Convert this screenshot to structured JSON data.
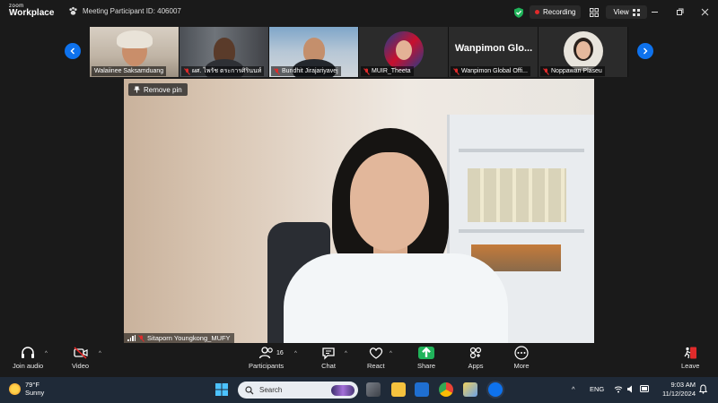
{
  "app": {
    "brand_line1": "zoom",
    "brand_line2": "Workplace",
    "meeting_id": "Meeting Participant ID: 406007",
    "recording_label": "Recording",
    "view_label": "View"
  },
  "thumbnails": [
    {
      "name": "Walaiinee Saksamduang",
      "muted": false
    },
    {
      "name": "ผศ. ไพรัช ตระการศิรินนท์",
      "muted": true
    },
    {
      "name": "Bundhit Jirajariyavej",
      "muted": true
    },
    {
      "name": "MUIR_Theeta",
      "muted": true
    },
    {
      "name": "Wanpimon Global Offi...",
      "muted": true,
      "display_text": "Wanpimon  Glo..."
    },
    {
      "name": "Noppawan Plaseu",
      "muted": true
    }
  ],
  "main_video": {
    "remove_pin_label": "Remove pin",
    "speaker_name": "Sitaporn Youngkong_MUFY"
  },
  "toolbar": {
    "join_audio": "Join audio",
    "video": "Video",
    "participants": "Participants",
    "participants_count": "16",
    "chat": "Chat",
    "react": "React",
    "share": "Share",
    "apps": "Apps",
    "more": "More",
    "leave": "Leave"
  },
  "taskbar": {
    "temp": "79°F",
    "condition": "Sunny",
    "search_label": "Search",
    "language": "ENG",
    "time": "9:03 AM",
    "date": "11/12/2024"
  },
  "colors": {
    "zoom_blue": "#0e72ed",
    "share_green": "#20b35a",
    "rec_red": "#e02b2b",
    "leave_red": "#e02b2b"
  }
}
